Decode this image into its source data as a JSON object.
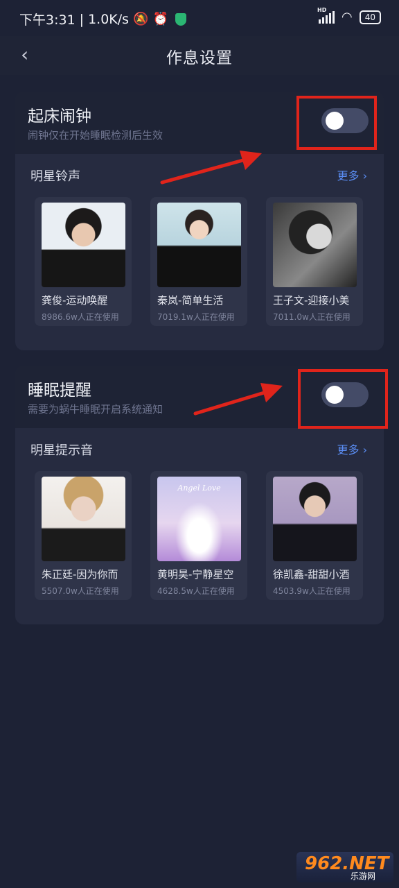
{
  "status_bar": {
    "time": "下午3:31",
    "speed": "1.0K/s",
    "battery": "40"
  },
  "header": {
    "title": "作息设置"
  },
  "alarm": {
    "title": "起床闹钟",
    "subtitle": "闹钟仅在开始睡眠检测后生效",
    "toggle_on": false,
    "section_title": "明星铃声",
    "more_label": "更多 ›",
    "items": [
      {
        "name": "龚俊-运动唤醒",
        "count": "8986.6w人正在使用"
      },
      {
        "name": "秦岚-简单生活",
        "count": "7019.1w人正在使用"
      },
      {
        "name": "王子文-迎接小美",
        "count": "7011.0w人正在使用"
      }
    ]
  },
  "sleep_reminder": {
    "title": "睡眠提醒",
    "subtitle": "需要为蜗牛睡眠开启系统通知",
    "toggle_on": false,
    "section_title": "明星提示音",
    "more_label": "更多 ›",
    "items": [
      {
        "name": "朱正廷-因为你而",
        "count": "5507.0w人正在使用"
      },
      {
        "name": "黄明昊-宁静星空",
        "count": "4628.5w人正在使用"
      },
      {
        "name": "徐凯鑫-甜甜小酒",
        "count": "4503.9w人正在使用"
      }
    ],
    "cover_text": "Angel Love"
  },
  "watermark": {
    "main": "962.NET",
    "sub": "乐游网"
  },
  "colors": {
    "background": "#1d2235",
    "card": "#262b40",
    "accent_link": "#5b8ef5",
    "annotation_red": "#e0241b"
  }
}
